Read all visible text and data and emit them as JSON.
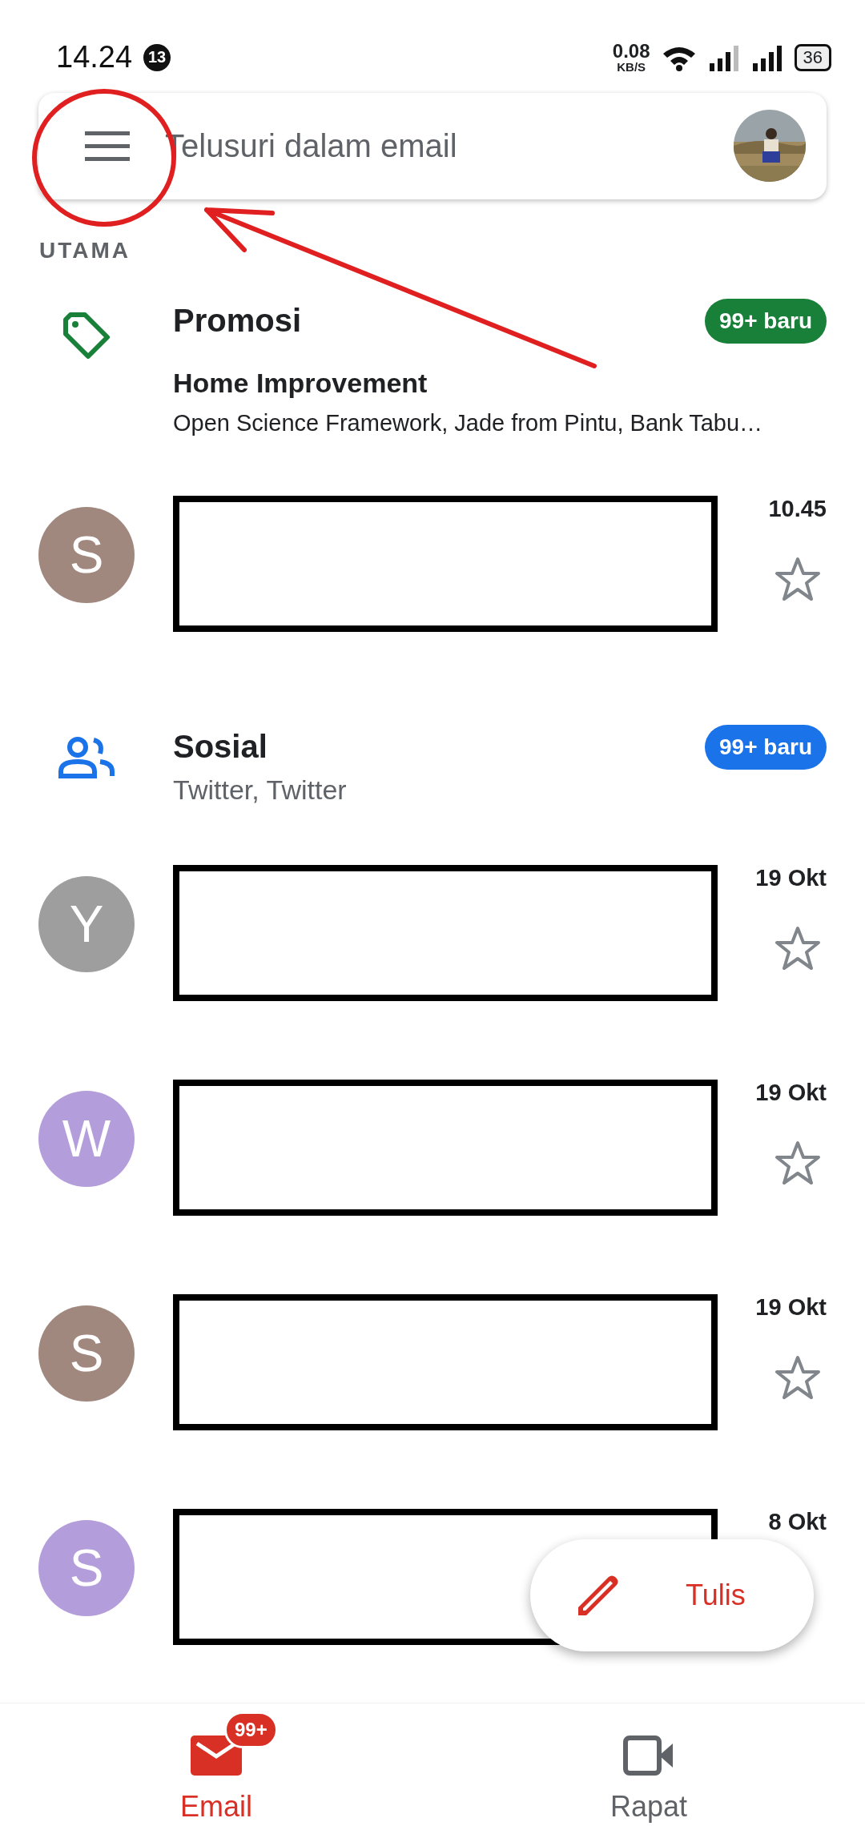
{
  "status_bar": {
    "time": "14.24",
    "notification_count": "13",
    "net_speed": "0.08",
    "net_unit": "KB/S",
    "battery": "36"
  },
  "search": {
    "placeholder": "Telusuri dalam email"
  },
  "section_label": "UTAMA",
  "items": [
    {
      "kind": "category",
      "color": "#188038",
      "title": "Promosi",
      "badge": "99+ baru",
      "headline": "Home Improvement",
      "snippet": "Open Science Framework, Jade from Pintu, Bank Tabu…"
    },
    {
      "kind": "email",
      "initial": "S",
      "color": "#a1887f",
      "date": "10.45",
      "starred": false
    },
    {
      "kind": "category",
      "color": "#1a73e8",
      "title": "Sosial",
      "badge": "99+ baru",
      "senders": "Twitter, Twitter"
    },
    {
      "kind": "email",
      "initial": "Y",
      "color": "#9e9e9e",
      "date": "19 Okt",
      "starred": false
    },
    {
      "kind": "email",
      "initial": "W",
      "color": "#b39ddb",
      "date": "19 Okt",
      "starred": false
    },
    {
      "kind": "email",
      "initial": "S",
      "color": "#a1887f",
      "date": "19 Okt",
      "starred": false
    },
    {
      "kind": "email",
      "initial": "S",
      "color": "#b39ddb",
      "date": "8 Okt"
    }
  ],
  "compose": {
    "label": "Tulis"
  },
  "nav": [
    {
      "label": "Email",
      "selected": true,
      "badge": "99+"
    },
    {
      "label": "Rapat",
      "selected": false
    }
  ]
}
